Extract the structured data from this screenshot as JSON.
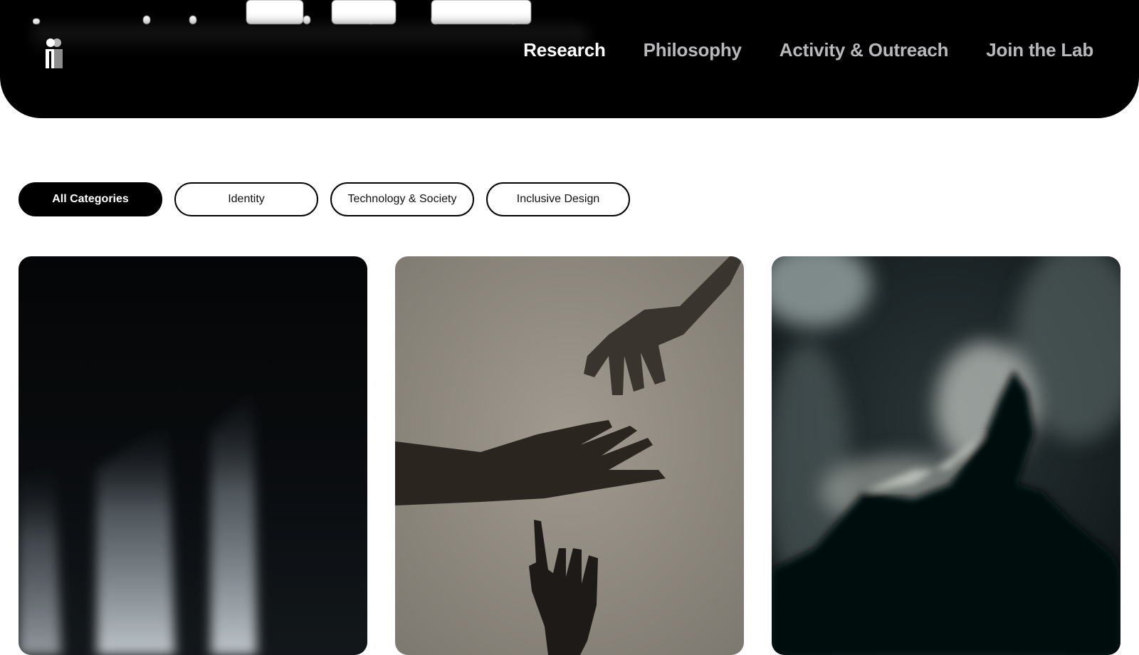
{
  "header": {
    "logo_icon": "lab-logo-icon",
    "nav": [
      {
        "label": "Research",
        "active": true
      },
      {
        "label": "Philosophy",
        "active": false
      },
      {
        "label": "Activity & Outreach",
        "active": false
      },
      {
        "label": "Join the Lab",
        "active": false
      }
    ]
  },
  "filters": [
    {
      "label": "All Categories",
      "active": true
    },
    {
      "label": "Identity",
      "active": false
    },
    {
      "label": "Technology & Society",
      "active": false
    },
    {
      "label": "Inclusive Design",
      "active": false
    }
  ],
  "cards": [
    {
      "image": "light-shadows-photo"
    },
    {
      "image": "reaching-hands-photo"
    },
    {
      "image": "blurred-silhouette-photo"
    }
  ],
  "colors": {
    "header_bg": "#000000",
    "nav_active": "#ffffff",
    "nav_inactive": "#b9b9bd",
    "pill_active_bg": "#000000"
  }
}
